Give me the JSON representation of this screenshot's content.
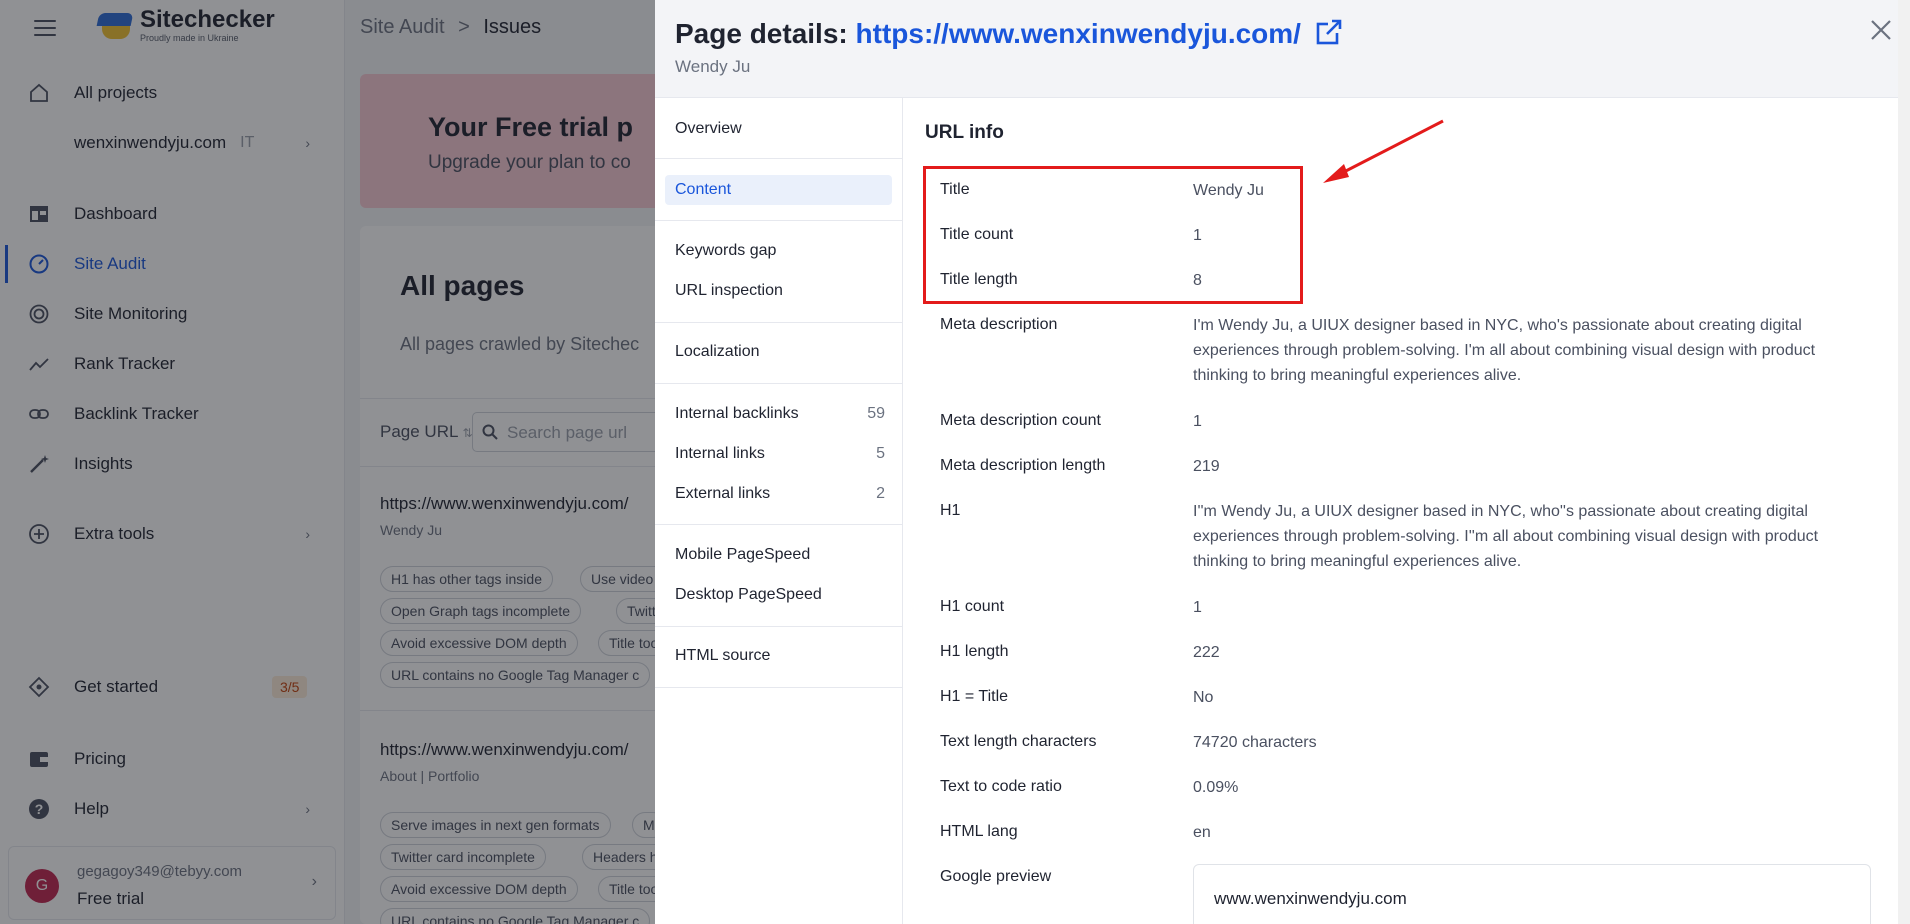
{
  "app": {
    "logo_name": "Sitechecker",
    "logo_sub": "Proudly made in Ukraine"
  },
  "sidebar": {
    "all_projects": "All projects",
    "project_name": "wenxinwendyju.com",
    "project_tag": "IT",
    "items": [
      {
        "label": "Dashboard",
        "icon": "dashboard-icon"
      },
      {
        "label": "Site Audit",
        "icon": "gauge-icon",
        "active": true
      },
      {
        "label": "Site Monitoring",
        "icon": "monitoring-icon"
      },
      {
        "label": "Rank Tracker",
        "icon": "trend-icon"
      },
      {
        "label": "Backlink Tracker",
        "icon": "link-icon"
      },
      {
        "label": "Insights",
        "icon": "magic-wand-icon"
      }
    ],
    "extra_tools": "Extra tools",
    "get_started": "Get started",
    "get_started_badge": "3/5",
    "pricing": "Pricing",
    "help": "Help",
    "user": {
      "initial": "G",
      "email": "gegagoy349@tebyy.com",
      "plan": "Free trial"
    }
  },
  "main": {
    "breadcrumb_parent": "Site Audit",
    "breadcrumb_sep": ">",
    "breadcrumb_current": "Issues",
    "trial_title": "Your Free trial p",
    "trial_text": "Upgrade your plan to co",
    "all_pages_title": "All pages",
    "all_pages_sub": "All pages crawled by Sitechec",
    "page_url_label": "Page URL",
    "search_placeholder": "Search page url",
    "pages": [
      {
        "url": "https://www.wenxinwendyju.com/",
        "title": "Wendy Ju",
        "tags": [
          "H1 has other tags inside",
          "Use video fo",
          "Open Graph tags incomplete",
          "Twitte",
          "Avoid excessive DOM depth",
          "Title too",
          "URL contains no Google Tag Manager c"
        ]
      },
      {
        "url": "https://www.wenxinwendyju.com/",
        "title": "About | Portfolio",
        "tags": [
          "Serve images in next gen formats",
          "M",
          "Twitter card incomplete",
          "Headers hi",
          "Avoid excessive DOM depth",
          "Title too",
          "URL contains no Google Tag Manager c"
        ]
      }
    ]
  },
  "drawer": {
    "title_prefix": "Page details:",
    "title_url": "https://www.wenxinwendyju.com/",
    "subtitle": "Wendy Ju",
    "tabs": {
      "overview": "Overview",
      "content": "Content",
      "keywords_gap": "Keywords gap",
      "url_inspection": "URL inspection",
      "localization": "Localization",
      "internal_backlinks": "Internal backlinks",
      "internal_backlinks_count": "59",
      "internal_links": "Internal links",
      "internal_links_count": "5",
      "external_links": "External links",
      "external_links_count": "2",
      "mobile_pagespeed": "Mobile PageSpeed",
      "desktop_pagespeed": "Desktop PageSpeed",
      "html_source": "HTML source"
    },
    "section_title": "URL info",
    "rows": [
      {
        "label": "Title",
        "value": "Wendy Ju"
      },
      {
        "label": "Title count",
        "value": "1"
      },
      {
        "label": "Title length",
        "value": "8"
      },
      {
        "label": "Meta description",
        "value": "I'm Wendy Ju, a UIUX designer based in NYC, who's passionate about creating digital experiences through problem-solving. I'm all about combining visual design with product thinking to bring meaningful experiences alive."
      },
      {
        "label": "Meta description count",
        "value": "1"
      },
      {
        "label": "Meta description length",
        "value": "219"
      },
      {
        "label": "H1",
        "value": "I''m Wendy Ju, a UIUX designer based in NYC, who''s passionate about creating digital experiences through problem-solving. I''m all about combining visual design with product thinking to bring meaningful experiences alive."
      },
      {
        "label": "H1 count",
        "value": "1"
      },
      {
        "label": "H1 length",
        "value": "222"
      },
      {
        "label": "H1 = Title",
        "value": "No"
      },
      {
        "label": "Text length characters",
        "value": "74720 characters"
      },
      {
        "label": "Text to code ratio",
        "value": "0.09%"
      },
      {
        "label": "HTML lang",
        "value": "en"
      },
      {
        "label": "Google preview",
        "value": ""
      }
    ],
    "google_preview_url": "www.wenxinwendyju.com"
  },
  "colors": {
    "accent": "#1a56db",
    "highlight_red": "#e31b1b",
    "trial_pink": "#f8c9d3"
  }
}
